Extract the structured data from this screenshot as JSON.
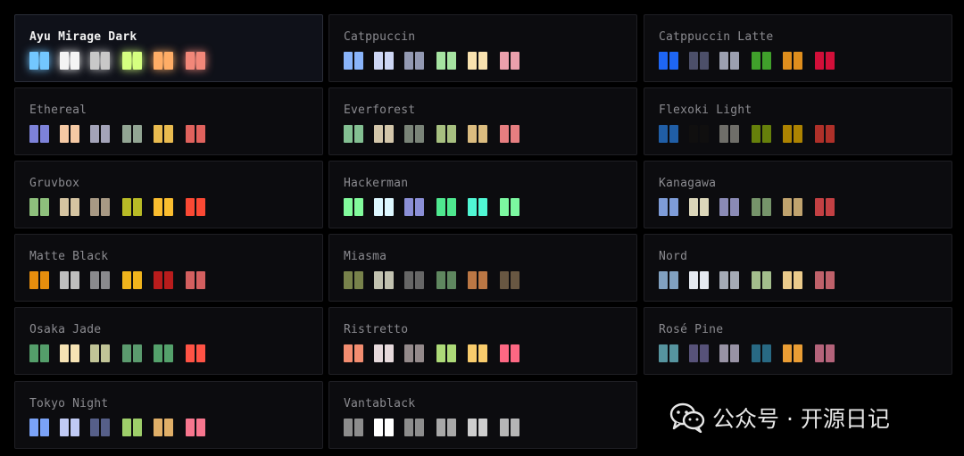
{
  "selected_theme": "Ayu Mirage Dark",
  "themes": [
    {
      "name": "Ayu Mirage Dark",
      "colors": [
        "#73c7ff",
        "#f4f4f4",
        "#c8c8c8",
        "#d5ff80",
        "#ffad66",
        "#f28779"
      ]
    },
    {
      "name": "Catppuccin",
      "colors": [
        "#89b4fa",
        "#cdd6f4",
        "#9399b2",
        "#a6e3a1",
        "#f9e2af",
        "#eba0ac"
      ]
    },
    {
      "name": "Catppuccin Latte",
      "colors": [
        "#1e66f5",
        "#4c4f69",
        "#9ca0b0",
        "#40a02b",
        "#df8e1d",
        "#d20f39"
      ]
    },
    {
      "name": "Ethereal",
      "colors": [
        "#7d82d9",
        "#f5c9a4",
        "#a3a3b8",
        "#92a593",
        "#e9bb4f",
        "#e0625d"
      ]
    },
    {
      "name": "Everforest",
      "colors": [
        "#83c092",
        "#d3c6aa",
        "#7a8478",
        "#a7c080",
        "#dbbc7f",
        "#e67e80"
      ]
    },
    {
      "name": "Flexoki Light",
      "colors": [
        "#205ea6",
        "#100f0f",
        "#6f6e69",
        "#66800b",
        "#ad8301",
        "#af3029"
      ]
    },
    {
      "name": "Gruvbox",
      "colors": [
        "#8ec07c",
        "#d5c4a1",
        "#a89984",
        "#b8bb26",
        "#fabd2f",
        "#fb4934"
      ]
    },
    {
      "name": "Hackerman",
      "colors": [
        "#82fb9c",
        "#ddf7ff",
        "#8b8fd6",
        "#4fe88f",
        "#50f7d4",
        "#7cf8a0"
      ]
    },
    {
      "name": "Kanagawa",
      "colors": [
        "#7e9cd8",
        "#dcd7ba",
        "#8a8ab5",
        "#76946a",
        "#c0a36e",
        "#c34043"
      ]
    },
    {
      "name": "Matte Black",
      "colors": [
        "#e68e0d",
        "#bebebe",
        "#8a8a8d",
        "#f0b41c",
        "#b91c1c",
        "#d35f5f"
      ]
    },
    {
      "name": "Miasma",
      "colors": [
        "#78824b",
        "#c2c2b0",
        "#666666",
        "#5f875f",
        "#bb7744",
        "#685742"
      ]
    },
    {
      "name": "Nord",
      "colors": [
        "#81a1c1",
        "#e5e9f0",
        "#a5abb6",
        "#a3be8c",
        "#ebcb8b",
        "#bf616a"
      ]
    },
    {
      "name": "Osaka Jade",
      "colors": [
        "#549e6a",
        "#f6e3b4",
        "#c1c497",
        "#5b9b6e",
        "#54a16b",
        "#ff5345"
      ]
    },
    {
      "name": "Ristretto",
      "colors": [
        "#f38d70",
        "#e6d9db",
        "#948a8b",
        "#adda78",
        "#f9cc6c",
        "#fd6883"
      ]
    },
    {
      "name": "Rosé Pine",
      "colors": [
        "#56949f",
        "#575279",
        "#9893a5",
        "#286983",
        "#ea9d34",
        "#b4637a"
      ]
    },
    {
      "name": "Tokyo Night",
      "colors": [
        "#7aa2f7",
        "#c0caf5",
        "#565f89",
        "#9ece6a",
        "#e0af68",
        "#f7768e"
      ]
    },
    {
      "name": "Vantablack",
      "colors": [
        "#8d8d8d",
        "#ffffff",
        "#8d8d8d",
        "#a8a8a8",
        "#cecece",
        "#b6b6b6"
      ]
    }
  ],
  "watermark": {
    "icon": "wechat-icon",
    "text": "公众号 · 开源日记"
  }
}
